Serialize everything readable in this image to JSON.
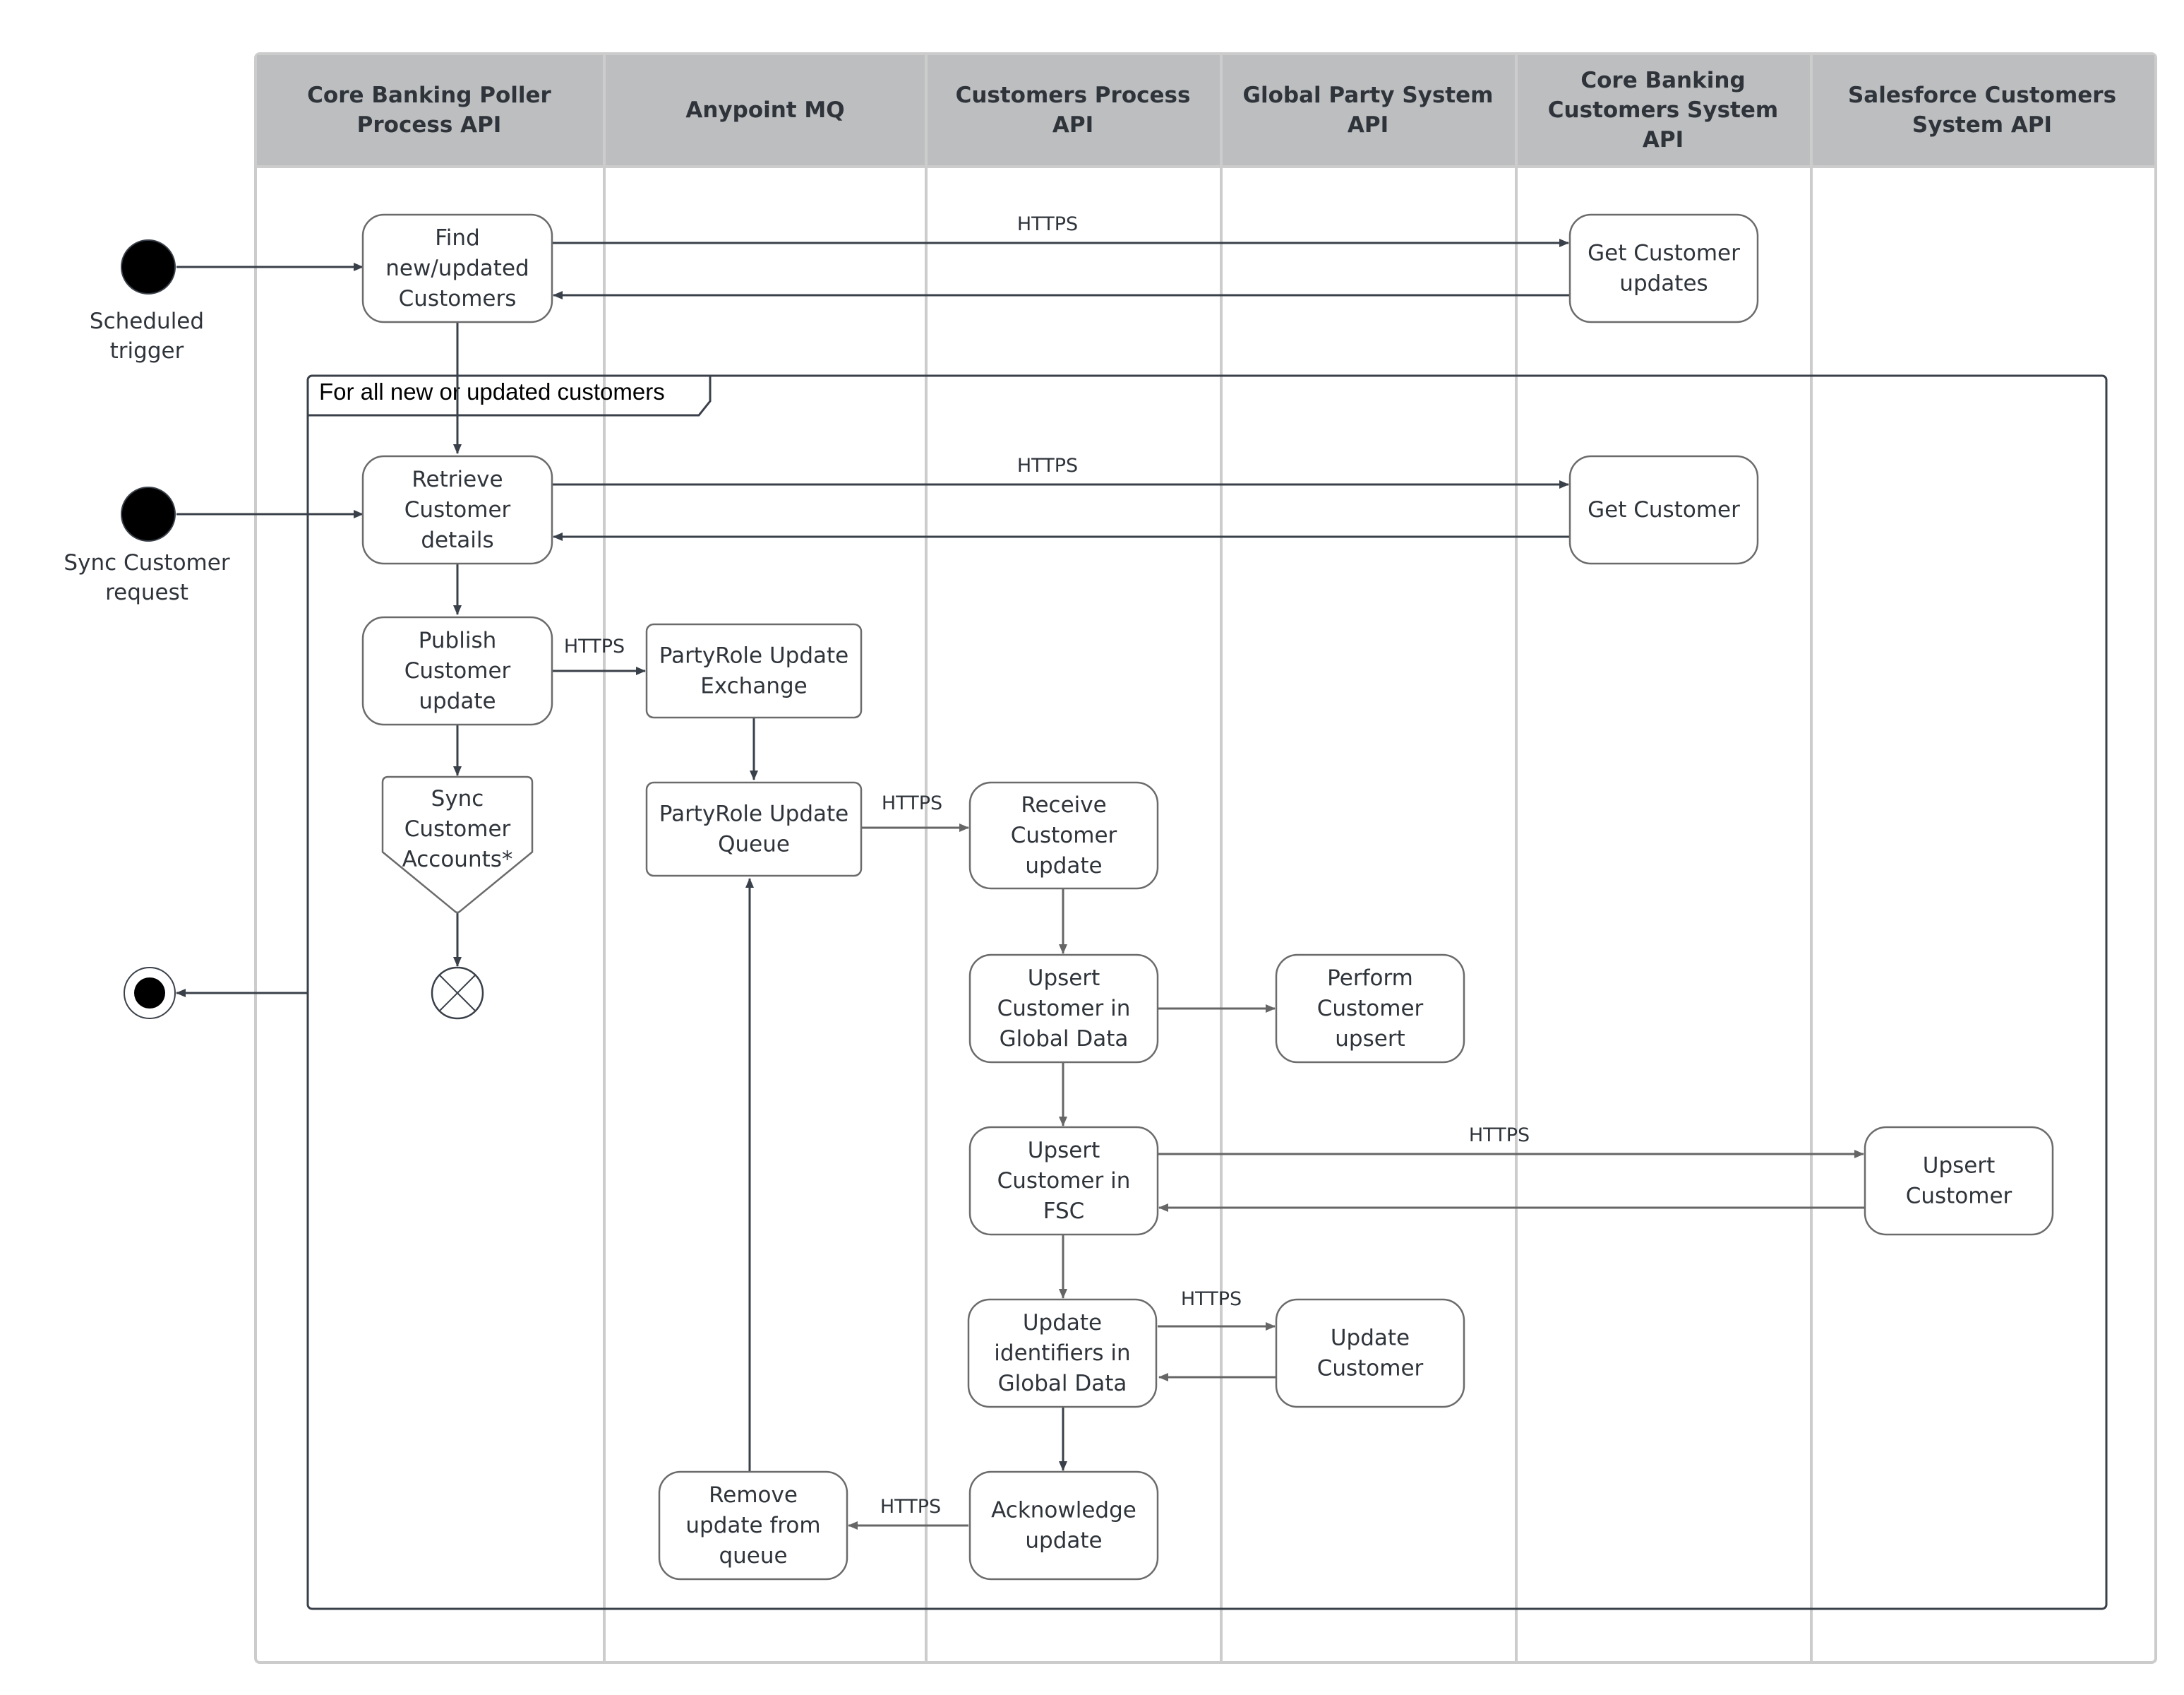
{
  "colors": {
    "header_fill": "#bdbec0",
    "lane_line": "#cccccc",
    "node_stroke": "#6b6b6b",
    "edge_dark": "#3a4049",
    "edge_gray": "#666666",
    "text": "#2f343b"
  },
  "lanes": [
    {
      "id": "poller",
      "title_lines": [
        "Core Banking Poller",
        "Process API"
      ]
    },
    {
      "id": "mq",
      "title_lines": [
        "Anypoint MQ"
      ]
    },
    {
      "id": "cpapi",
      "title_lines": [
        "Customers Process",
        "API"
      ]
    },
    {
      "id": "gps",
      "title_lines": [
        "Global Party System",
        "API"
      ]
    },
    {
      "id": "cbcs",
      "title_lines": [
        "Core Banking",
        "Customers System",
        "API"
      ]
    },
    {
      "id": "sfcs",
      "title_lines": [
        "Salesforce Customers",
        "System API"
      ]
    }
  ],
  "start_nodes": [
    {
      "id": "scheduled",
      "label_lines": [
        "Scheduled",
        "trigger"
      ]
    },
    {
      "id": "sync_request",
      "label_lines": [
        "Sync Customer",
        "request"
      ]
    }
  ],
  "frame": {
    "title": "For all new or updated customers"
  },
  "nodes": [
    {
      "id": "find",
      "lines": [
        "Find",
        "new/updated",
        "Customers"
      ]
    },
    {
      "id": "get_updates",
      "lines": [
        "Get Customer",
        "updates"
      ]
    },
    {
      "id": "retrieve",
      "lines": [
        "Retrieve",
        "Customer",
        "details"
      ]
    },
    {
      "id": "get_customer",
      "lines": [
        "Get Customer"
      ]
    },
    {
      "id": "publish",
      "lines": [
        "Publish",
        "Customer",
        "update"
      ]
    },
    {
      "id": "exchange",
      "lines": [
        "PartyRole Update",
        "Exchange"
      ]
    },
    {
      "id": "sync_accounts",
      "lines": [
        "Sync",
        "Customer",
        "Accounts*"
      ]
    },
    {
      "id": "queue",
      "lines": [
        "PartyRole Update",
        "Queue"
      ]
    },
    {
      "id": "receive",
      "lines": [
        "Receive",
        "Customer",
        "update"
      ]
    },
    {
      "id": "upsert_global",
      "lines": [
        "Upsert",
        "Customer in",
        "Global Data"
      ]
    },
    {
      "id": "perform_upsert",
      "lines": [
        "Perform",
        "Customer",
        "upsert"
      ]
    },
    {
      "id": "upsert_fsc",
      "lines": [
        "Upsert",
        "Customer in",
        "FSC"
      ]
    },
    {
      "id": "upsert_customer",
      "lines": [
        "Upsert",
        "Customer"
      ]
    },
    {
      "id": "update_ids",
      "lines": [
        "Update",
        "identifiers in",
        "Global Data"
      ]
    },
    {
      "id": "update_customer",
      "lines": [
        "Update",
        "Customer"
      ]
    },
    {
      "id": "acknowledge",
      "lines": [
        "Acknowledge",
        "update"
      ]
    },
    {
      "id": "remove",
      "lines": [
        "Remove",
        "update from",
        "queue"
      ]
    }
  ],
  "edge_labels": {
    "find_to_get_updates": "HTTPS",
    "retrieve_to_get_customer": "HTTPS",
    "publish_to_exchange": "HTTPS",
    "queue_to_receive": "HTTPS",
    "fsc_to_upsert_customer": "HTTPS",
    "ids_to_update_customer": "HTTPS",
    "ack_to_remove": "HTTPS"
  }
}
